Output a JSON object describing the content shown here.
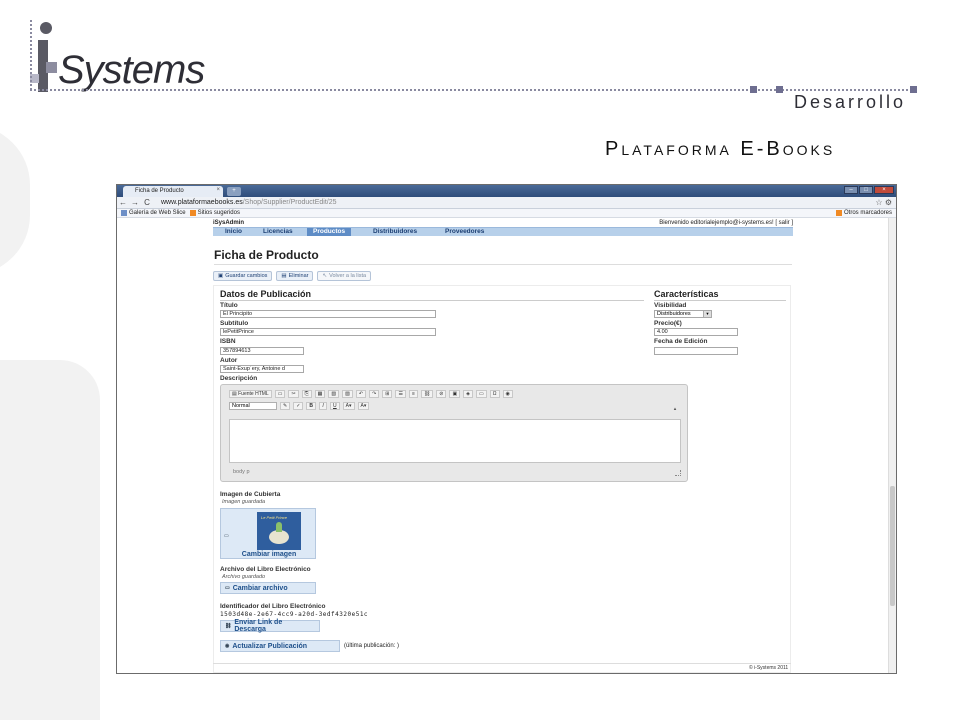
{
  "slide": {
    "logo_text": "Systems",
    "tagline": "Desarrollo",
    "title": "Plataforma E-Books"
  },
  "browser": {
    "tab_title": "Ficha de Producto",
    "tab_close": "×",
    "new_tab": "+",
    "url_host": "www.plataformaebooks.es",
    "url_path": "/Shop/Supplier/ProductEdit/25",
    "bookmarks": [
      "Galería de Web Slice",
      "Sitios sugeridos"
    ],
    "other_bookmarks": "Otros marcadores"
  },
  "app": {
    "name": "iSysAdmin",
    "welcome": "Bienvenido editorialejemplo@i-systems.es! [ salir ]",
    "nav": [
      "Inicio",
      "Licencias",
      "Productos",
      "Distribuidores",
      "Proveedores"
    ],
    "active_nav": "Productos",
    "page_title": "Ficha de Producto",
    "actions": {
      "save": "Guardar cambios",
      "delete": "Eliminar",
      "back": "Volver a la lista"
    },
    "publication": {
      "heading": "Datos de Publicación",
      "title_label": "Título",
      "title_value": "El Principito",
      "subtitle_label": "Subtítulo",
      "subtitle_value": "lePetitPrince",
      "isbn_label": "ISBN",
      "isbn_value": "357894613",
      "author_label": "Autor",
      "author_value": "Saint-Exup´ery, Antoine d",
      "description_label": "Descripción"
    },
    "editor": {
      "source_button": "Fuente HTML",
      "format_value": "Normal",
      "bold": "B",
      "italic": "I",
      "underline": "U",
      "path": "body  p"
    },
    "characteristics": {
      "heading": "Características",
      "visibility_label": "Visibilidad",
      "visibility_value": "Distribuidores",
      "price_label": "Precio(€)",
      "price_value": "4.00",
      "edition_date_label": "Fecha de Edición",
      "edition_date_value": ""
    },
    "cover": {
      "label": "Imagen de Cubierta",
      "status": "Imagen guardada",
      "button": "Cambiar imagen",
      "book_title": "Le Petit Prince"
    },
    "ebook_file": {
      "label": "Archivo del Libro Electrónico",
      "status": "Archivo guardado",
      "button": "Cambiar archivo"
    },
    "ebook_id": {
      "label": "Identificador del Libro Electrónico",
      "value": "1503d48e-2e67-4cc9-a20d-3edf4320e51c",
      "send_button": "Enviar Link de Descarga"
    },
    "publish": {
      "button": "Actualizar Publicación",
      "note": "(última publicación: )"
    },
    "footer": "© i-Systems 2011"
  }
}
